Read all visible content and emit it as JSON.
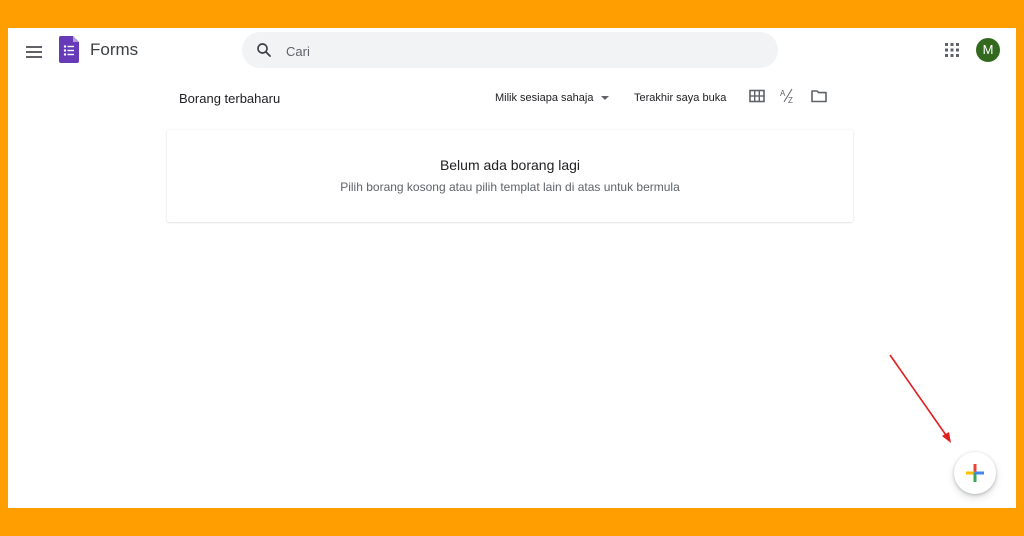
{
  "header": {
    "app_name": "Forms",
    "search": {
      "placeholder": "Cari",
      "value": ""
    },
    "avatar_initial": "M",
    "avatar_color": "#33691e"
  },
  "toolbar": {
    "section_title": "Borang terbaharu",
    "owner_filter": "Milik sesiapa sahaja",
    "sort_label": "Terakhir saya buka",
    "icons": [
      "grid-view-icon",
      "sort-az-icon",
      "folder-icon"
    ]
  },
  "empty_state": {
    "title": "Belum ada borang lagi",
    "subtitle": "Pilih borang kosong atau pilih templat lain di atas untuk bermula"
  },
  "fab": {
    "icon": "plus-icon",
    "colors": [
      "#ea4335",
      "#fbbc04",
      "#34a853",
      "#4285f4"
    ]
  },
  "annotation": {
    "icon": "arrow-icon",
    "color": "#e01e1e"
  },
  "colors": {
    "frame_border": "#FF9E00",
    "forms_purple": "#673ab7"
  }
}
